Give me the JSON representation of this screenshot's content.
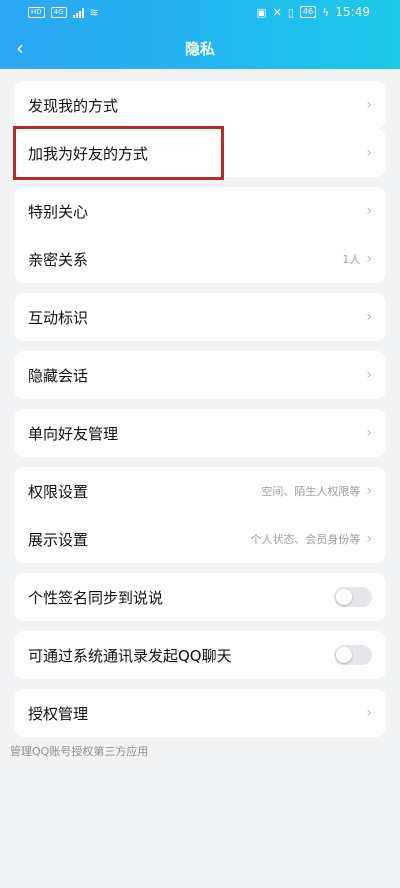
{
  "status_bar": {
    "sim1": "HD",
    "sim2": "4G",
    "battery": "46",
    "time": "15:49"
  },
  "nav": {
    "title": "隐私",
    "back_icon": "chevron-left-icon"
  },
  "sections": [
    {
      "items": [
        {
          "label": "发现我的方式"
        }
      ]
    },
    {
      "items": [
        {
          "label": "加我为好友的方式",
          "highlighted": true
        }
      ]
    },
    {
      "items": [
        {
          "label": "特别关心"
        },
        {
          "label": "亲密关系",
          "detail": "1人"
        }
      ]
    },
    {
      "items": [
        {
          "label": "互动标识"
        }
      ]
    },
    {
      "items": [
        {
          "label": "隐藏会话"
        }
      ]
    },
    {
      "items": [
        {
          "label": "单向好友管理"
        }
      ]
    },
    {
      "items": [
        {
          "label": "权限设置",
          "detail": "空间、陌生人权限等"
        },
        {
          "label": "展示设置",
          "detail": "个人状态、会员身份等"
        }
      ]
    },
    {
      "items": [
        {
          "label": "个性签名同步到说说",
          "toggle": false
        }
      ]
    },
    {
      "items": [
        {
          "label": "可通过系统通讯录发起QQ聊天",
          "toggle": false
        }
      ]
    },
    {
      "items": [
        {
          "label": "授权管理"
        }
      ]
    }
  ],
  "footer_note": "管理QQ账号授权第三方应用",
  "colors": {
    "header_gradient_start": "#2ca6f5",
    "header_gradient_end": "#1ccaea",
    "highlight_border": "#b52b2b",
    "background": "#f2f3f5"
  }
}
